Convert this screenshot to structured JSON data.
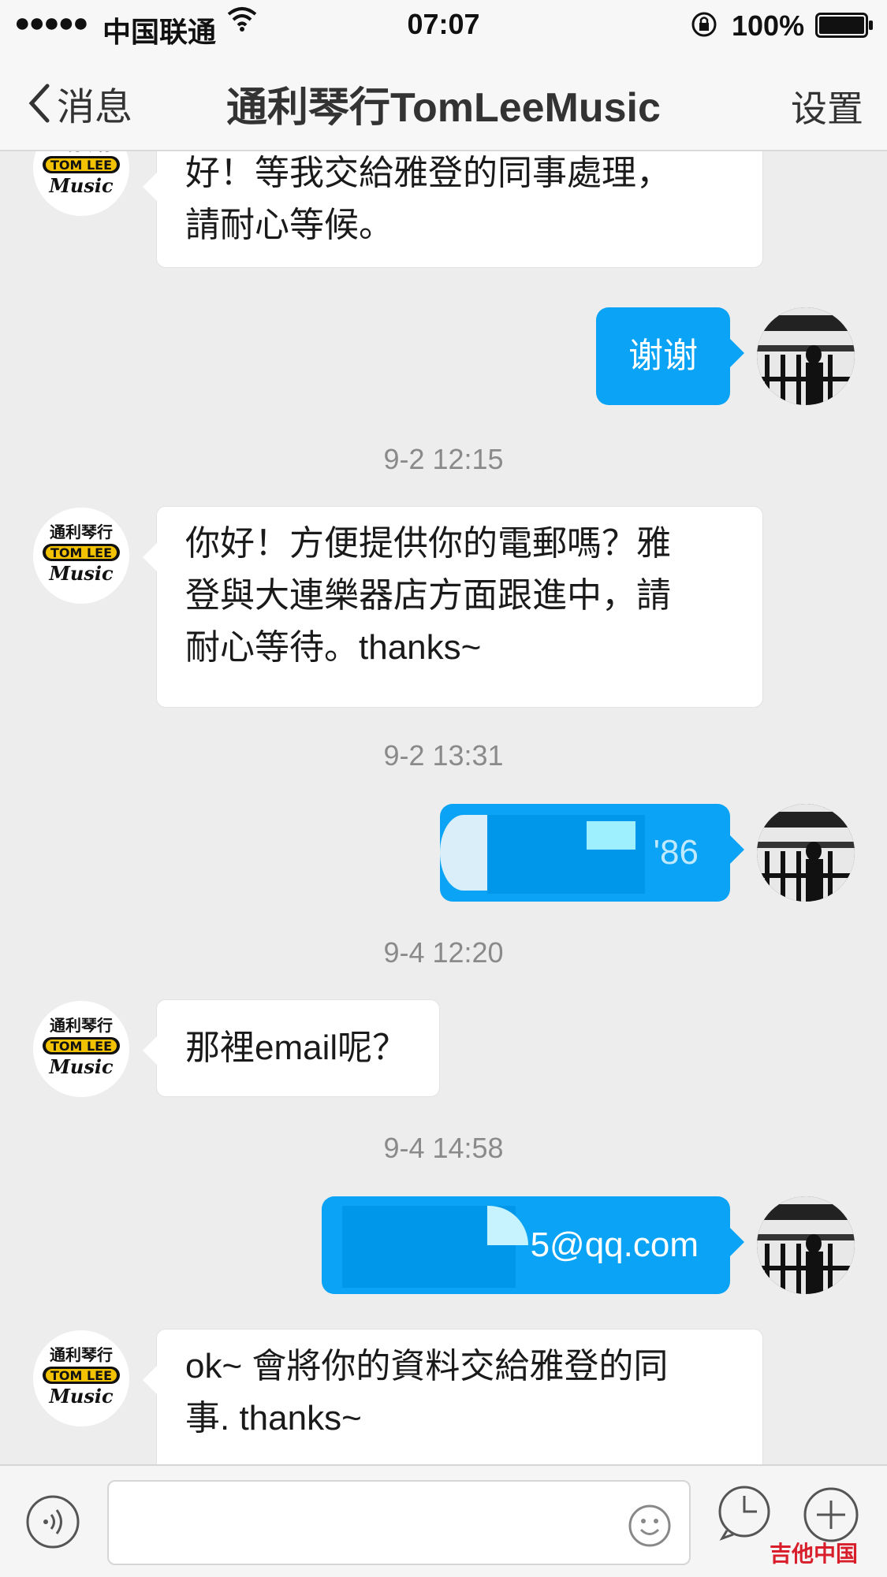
{
  "status_bar": {
    "signal": "●●●●●",
    "carrier": "中国联通",
    "time": "07:07",
    "battery_percent": "100%"
  },
  "nav": {
    "back_label": "消息",
    "title": "通利琴行TomLeeMusic",
    "settings_label": "设置"
  },
  "messages": [
    {
      "side": "left",
      "text_lines": [
        "好！等我交給雅登的同事處理，",
        "請耐心等候。"
      ]
    },
    {
      "side": "right",
      "text": "谢谢"
    },
    {
      "type": "timestamp",
      "text": "9-2 12:15"
    },
    {
      "side": "left",
      "text_lines": [
        "你好！方便提供你的電郵嗎？雅",
        "登與大連樂器店方面跟進中，請",
        "耐心等待。thanks~"
      ]
    },
    {
      "type": "timestamp",
      "text": "9-2 13:31"
    },
    {
      "side": "right",
      "text": "'86"
    },
    {
      "type": "timestamp",
      "text": "9-4 12:20"
    },
    {
      "side": "left",
      "text": "那裡email呢？"
    },
    {
      "type": "timestamp",
      "text": "9-4 14:58"
    },
    {
      "side": "right",
      "text": "5@qq.com"
    },
    {
      "side": "left",
      "text_lines": [
        "ok~ 會將你的資料交給雅登的同",
        "事. thanks~"
      ]
    }
  ],
  "avatar_logo": {
    "line1": "通利琴行",
    "line2": "TOM LEE",
    "line3": "Music"
  },
  "watermark": "吉他中国",
  "colors": {
    "accent_blue": "#0aa3f5",
    "background": "#ededed",
    "logo_yellow": "#f2c200"
  },
  "icons": [
    "back-chevron-icon",
    "wifi-icon",
    "rotation-lock-icon",
    "battery-icon",
    "voice-icon",
    "emoji-icon",
    "clock-icon",
    "plus-icon"
  ]
}
